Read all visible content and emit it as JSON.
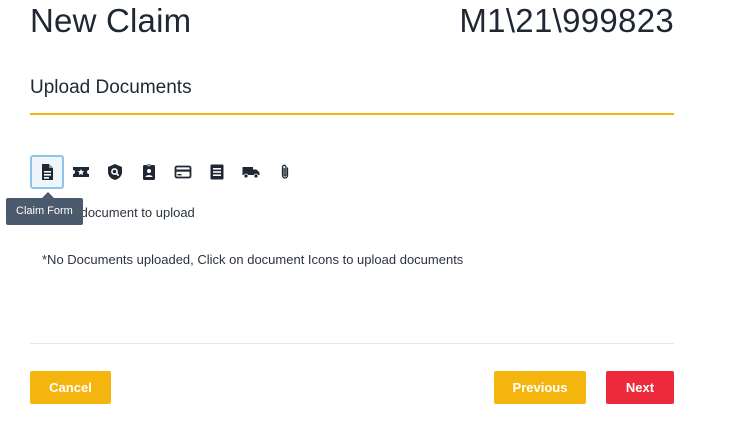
{
  "header": {
    "title": "New Claim",
    "claim_number": "M1\\21\\999823"
  },
  "section": {
    "title": "Upload Documents"
  },
  "document_icons": [
    {
      "name": "claim-form-icon",
      "tooltip": "Claim Form",
      "active": true
    },
    {
      "name": "ticket-icon"
    },
    {
      "name": "shield-icon"
    },
    {
      "name": "id-badge-icon"
    },
    {
      "name": "credit-card-icon"
    },
    {
      "name": "list-document-icon"
    },
    {
      "name": "truck-icon"
    },
    {
      "name": "paperclip-icon"
    }
  ],
  "tooltip": {
    "text": "Claim Form"
  },
  "instructions": {
    "select_text": "Select a document to upload",
    "no_documents": "*No Documents uploaded, Click on document Icons to upload documents"
  },
  "buttons": {
    "cancel": "Cancel",
    "previous": "Previous",
    "next": "Next"
  },
  "colors": {
    "accent": "#f5b50f",
    "danger": "#ec2a3c",
    "text": "#1f2733",
    "tooltip_bg": "#4b5a6c",
    "active_border": "#8fc3e8"
  }
}
